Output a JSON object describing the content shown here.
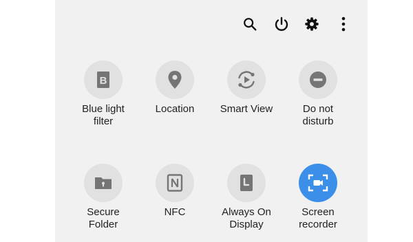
{
  "top_actions": [
    {
      "name": "search-button",
      "icon": "search-icon"
    },
    {
      "name": "power-button",
      "icon": "power-icon"
    },
    {
      "name": "settings-button",
      "icon": "gear-icon"
    },
    {
      "name": "more-options-button",
      "icon": "more-vertical-icon"
    }
  ],
  "tiles": [
    {
      "label": "Blue light\nfilter",
      "icon": "blue-light-filter-icon",
      "active": false
    },
    {
      "label": "Location",
      "icon": "location-pin-icon",
      "active": false
    },
    {
      "label": "Smart View",
      "icon": "smart-view-icon",
      "active": false
    },
    {
      "label": "Do not\ndisturb",
      "icon": "do-not-disturb-icon",
      "active": false
    },
    {
      "label": "Secure\nFolder",
      "icon": "secure-folder-icon",
      "active": false
    },
    {
      "label": "NFC",
      "icon": "nfc-icon",
      "active": false
    },
    {
      "label": "Always On\nDisplay",
      "icon": "always-on-display-icon",
      "active": false
    },
    {
      "label": "Screen\nrecorder",
      "icon": "screen-recorder-icon",
      "active": true
    }
  ],
  "colors": {
    "panel_bg": "#f1f1f1",
    "tile_bg": "#e1e1e1",
    "icon_color": "#757575",
    "active_bg": "#3b8fe9",
    "active_icon": "#ffffff",
    "text": "#222222"
  }
}
